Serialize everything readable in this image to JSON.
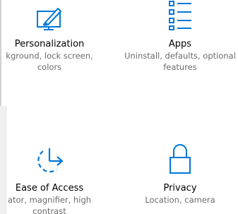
{
  "tiles": [
    {
      "id": "personalization",
      "title": "Personalization",
      "description": "kground, lock screen, colors",
      "icon": "personalization-icon"
    },
    {
      "id": "apps",
      "title": "Apps",
      "description": "Uninstall, defaults, optional features",
      "icon": "apps-list-icon"
    },
    {
      "id": "ease-of-access",
      "title": "Ease of Access",
      "description": "ator, magnifier, high contrast",
      "icon": "ease-of-access-icon"
    },
    {
      "id": "privacy",
      "title": "Privacy",
      "description": "Location, camera",
      "icon": "lock-icon"
    }
  ],
  "colors": {
    "accent": "#0078d7",
    "title": "#000000",
    "description": "#6b6b6b",
    "background": "#ffffff"
  }
}
